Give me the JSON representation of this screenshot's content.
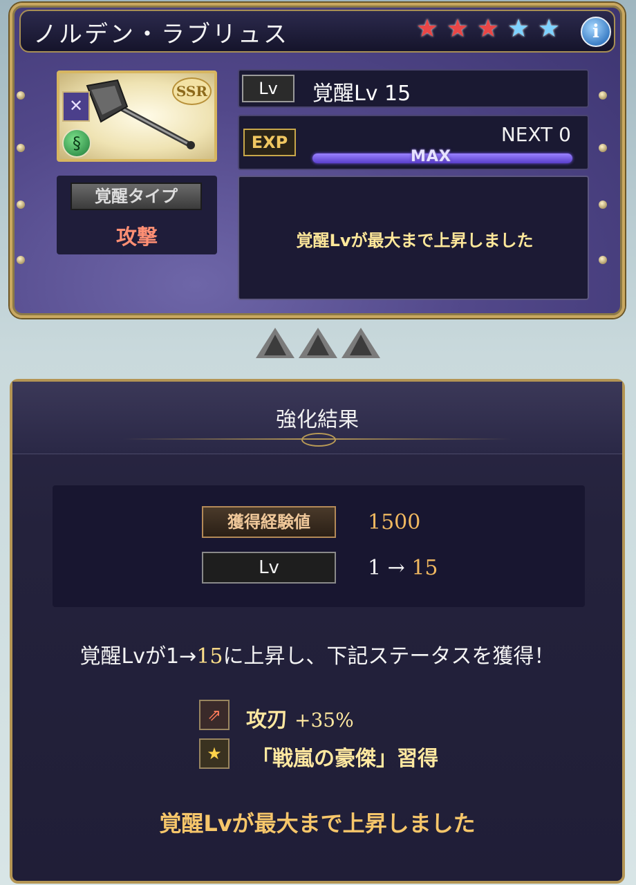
{
  "weapon": {
    "name": "ノルデン・ラブリュス",
    "stars": [
      {
        "icon": "star-icon",
        "color": "#ea4646"
      },
      {
        "icon": "star-icon",
        "color": "#ea4646"
      },
      {
        "icon": "star-icon",
        "color": "#ea4646"
      },
      {
        "icon": "star-icon",
        "color": "#7fd2ff"
      },
      {
        "icon": "star-icon",
        "color": "#7fd2ff"
      }
    ],
    "info_icon": "i",
    "rarity": "SSR",
    "awakening_type_label": "覚醒タイプ",
    "awakening_type_value": "攻撃",
    "lv_tag": "Lv",
    "lv_value": "覚醒Lv 15",
    "exp_tag": "EXP",
    "next_text": "NEXT 0",
    "exp_bar_label": "MAX",
    "exp_progress": 1.0,
    "status_message": "覚醒Lvが最大まで上昇しました"
  },
  "result": {
    "title": "強化結果",
    "exp_label": "獲得経験値",
    "exp_value": "1500",
    "lv_label": "Lv",
    "lv_from": "1",
    "lv_arrow": "→",
    "lv_to": "15",
    "gain_prefix": "覚醒Lvが",
    "gain_from": "1",
    "gain_arrow": "→",
    "gain_to": "15",
    "gain_suffix": "に上昇し、下記ステータスを獲得！",
    "skills": [
      {
        "name": "攻刃",
        "bonus": "+35%",
        "icon": "blade-up-icon"
      },
      {
        "name": "「戦嵐の豪傑」習得",
        "bonus": "",
        "icon": "star-icon"
      }
    ],
    "footer_message": "覚醒Lvが最大まで上昇しました"
  }
}
